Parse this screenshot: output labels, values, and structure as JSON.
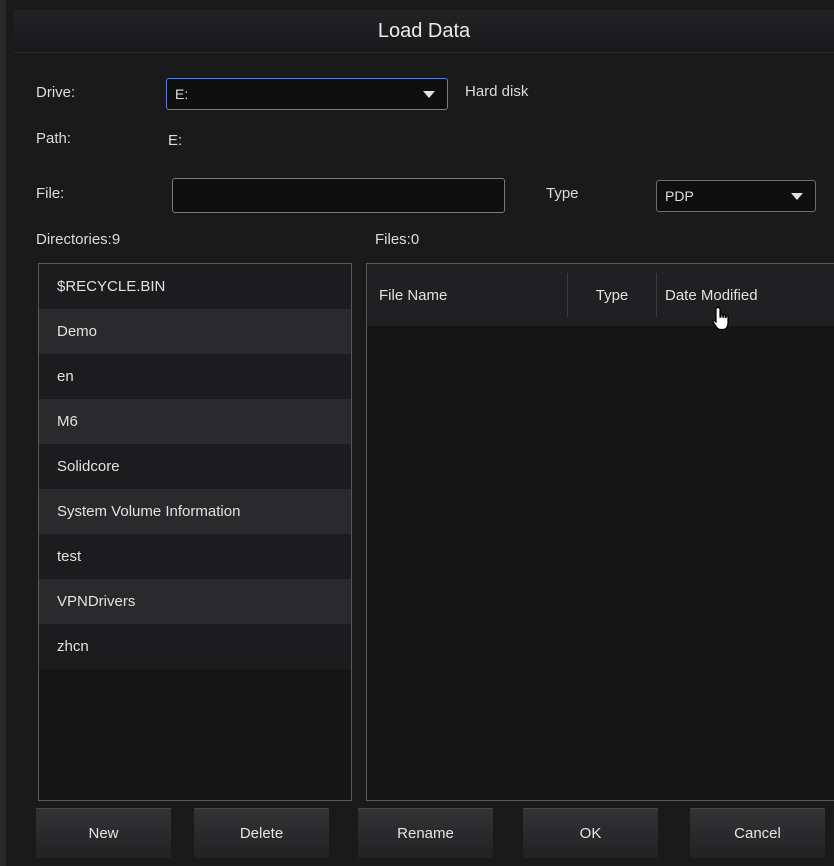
{
  "dialog": {
    "title": "Load Data"
  },
  "drive": {
    "label": "Drive:",
    "value": "E:",
    "description": "Hard disk"
  },
  "path": {
    "label": "Path:",
    "value": "E:"
  },
  "file": {
    "label": "File:",
    "value": "",
    "type_label": "Type",
    "type_value": "PDP"
  },
  "directories": {
    "label": "Directories:9",
    "items": [
      "$RECYCLE.BIN",
      "Demo",
      "en",
      "M6",
      "Solidcore",
      "System Volume Information",
      "test",
      "VPNDrivers",
      "zhcn"
    ]
  },
  "files": {
    "label": "Files:0",
    "columns": [
      "File Name",
      "Type",
      "Date Modified"
    ]
  },
  "buttons": {
    "new": "New",
    "delete": "Delete",
    "rename": "Rename",
    "ok": "OK",
    "cancel": "Cancel"
  },
  "icons": {
    "dropdown": "chevron-down-icon",
    "cursor": "hand-pointer-icon"
  }
}
